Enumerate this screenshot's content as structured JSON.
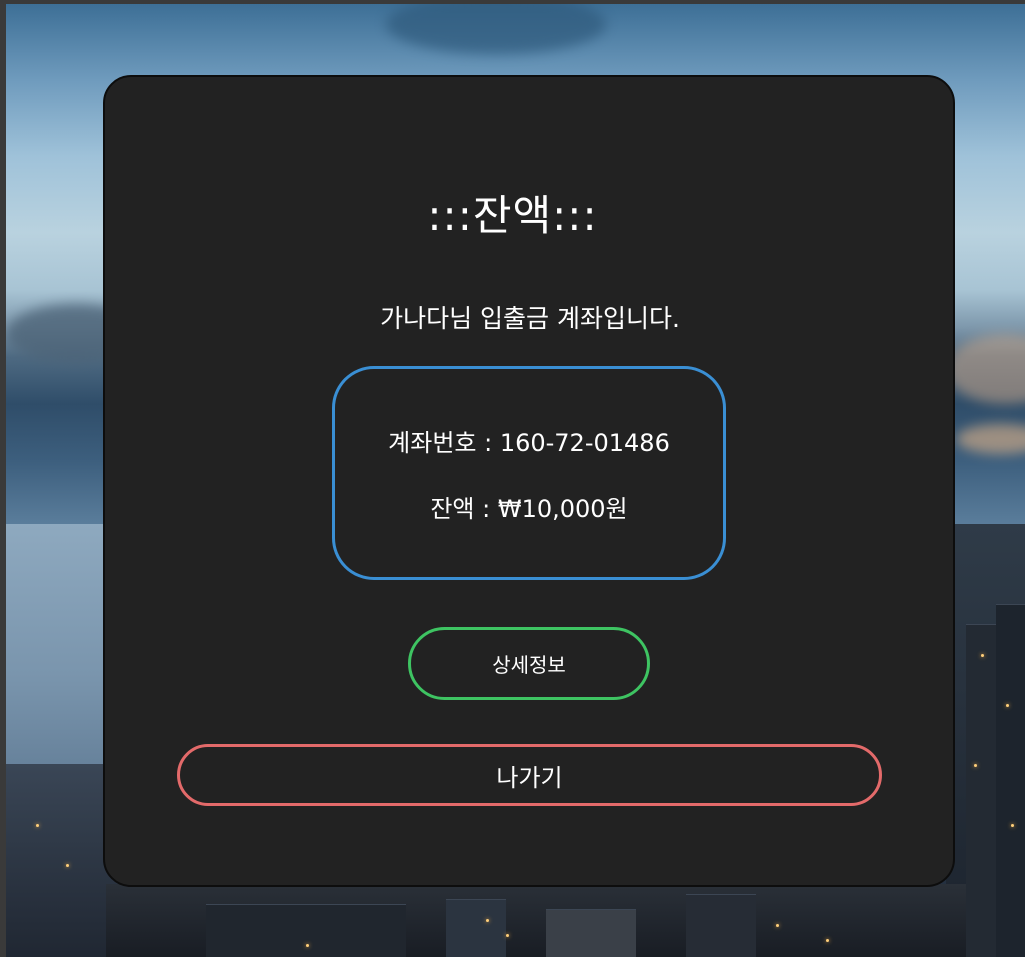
{
  "title": ":::잔액:::",
  "subtitle": "가나다님 입출금 계좌입니다.",
  "account": {
    "number_line": "계좌번호 : 160-72-01486",
    "balance_line": "잔액 : ₩10,000원"
  },
  "buttons": {
    "detail_label": "상세정보",
    "exit_label": "나가기"
  },
  "colors": {
    "panel_bg": "#222222",
    "info_border": "#3a8fd4",
    "detail_border": "#3ec462",
    "exit_border": "#e36a6a"
  }
}
